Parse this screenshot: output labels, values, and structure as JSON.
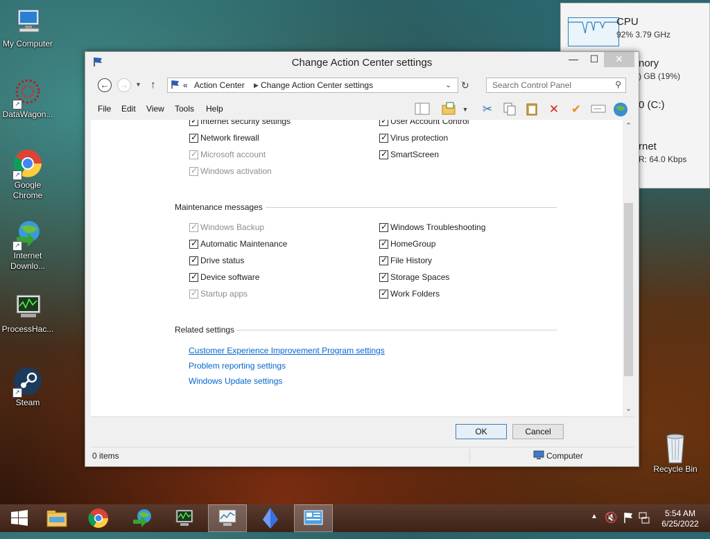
{
  "desktop": {
    "icons": [
      {
        "label": "My Computer"
      },
      {
        "label": "DataWagon..."
      },
      {
        "label": "Google Chrome"
      },
      {
        "label": "Internet Downlo..."
      },
      {
        "label": "ProcessHac..."
      },
      {
        "label": "Steam"
      },
      {
        "label": "Recycle Bin"
      }
    ]
  },
  "perf_widget": {
    "cpu_title": "CPU",
    "cpu_value": "92% 3.79 GHz",
    "memory_title": "nory",
    "memory_value": ") GB (19%)",
    "disk_title": "0 (C:)",
    "net_title": "rnet",
    "net_value": "R: 64.0 Kbps"
  },
  "window": {
    "title": "Change Action Center settings",
    "controls": {
      "minimize": "—",
      "maximize": "☐",
      "close": "✕"
    },
    "breadcrumb": [
      "Action Center",
      "Change Action Center settings"
    ],
    "breadcrumb_prefix": "«",
    "search_placeholder": "Search Control Panel",
    "menu": [
      "File",
      "Edit",
      "View",
      "Tools",
      "Help"
    ],
    "security_items_left": [
      {
        "label": "Internet security settings",
        "checked": true,
        "disabled": false
      },
      {
        "label": "Network firewall",
        "checked": true,
        "disabled": false
      },
      {
        "label": "Microsoft account",
        "checked": true,
        "disabled": true
      },
      {
        "label": "Windows activation",
        "checked": true,
        "disabled": true
      }
    ],
    "security_items_right": [
      {
        "label": "User Account Control",
        "checked": true,
        "disabled": false
      },
      {
        "label": "Virus protection",
        "checked": true,
        "disabled": false
      },
      {
        "label": "SmartScreen",
        "checked": true,
        "disabled": false
      }
    ],
    "maintenance": {
      "heading": "Maintenance messages",
      "left": [
        {
          "label": "Windows Backup",
          "checked": true,
          "disabled": true
        },
        {
          "label": "Automatic Maintenance",
          "checked": true,
          "disabled": false
        },
        {
          "label": "Drive status",
          "checked": true,
          "disabled": false
        },
        {
          "label": "Device software",
          "checked": true,
          "disabled": false
        },
        {
          "label": "Startup apps",
          "checked": true,
          "disabled": true
        }
      ],
      "right": [
        {
          "label": "Windows Troubleshooting",
          "checked": true,
          "disabled": false
        },
        {
          "label": "HomeGroup",
          "checked": true,
          "disabled": false
        },
        {
          "label": "File History",
          "checked": true,
          "disabled": false
        },
        {
          "label": "Storage Spaces",
          "checked": true,
          "disabled": false
        },
        {
          "label": "Work Folders",
          "checked": true,
          "disabled": false
        }
      ]
    },
    "related": {
      "heading": "Related settings",
      "links": [
        "Customer Experience Improvement Program settings",
        "Problem reporting settings",
        "Windows Update settings"
      ]
    },
    "buttons": {
      "ok": "OK",
      "cancel": "Cancel"
    },
    "status": {
      "items": "0 items",
      "location": "Computer"
    }
  },
  "taskbar": {
    "time": "5:54 AM",
    "date": "6/25/2022"
  },
  "colors": {
    "link": "#0066cc",
    "close_button": "#c7c7c7"
  }
}
